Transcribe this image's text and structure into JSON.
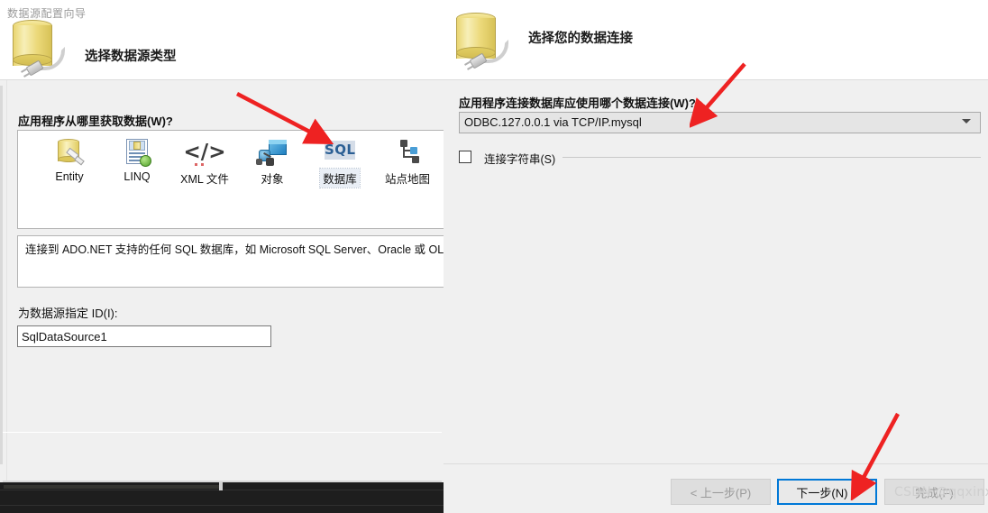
{
  "background": {
    "editor_color": "#1e1e1e"
  },
  "left_dialog": {
    "window_title": "数据源配置向导",
    "header_title": "选择数据源类型",
    "header_icon": "database-plug-icon",
    "question_label": "应用程序从哪里获取数据(W)?",
    "source_types": [
      {
        "label": "Entity",
        "icon": "entity-icon",
        "selected": false
      },
      {
        "label": "LINQ",
        "icon": "linq-icon",
        "selected": false
      },
      {
        "label": "XML 文件",
        "icon": "xml-file-icon",
        "selected": false
      },
      {
        "label": "对象",
        "icon": "object-icon",
        "selected": false
      },
      {
        "label": "数据库",
        "icon": "sql-database-icon",
        "selected": true
      },
      {
        "label": "站点地图",
        "icon": "site-map-icon",
        "selected": false
      }
    ],
    "description": "连接到 ADO.NET 支持的任何 SQL 数据库，如 Microsoft SQL Server、Oracle 或 OLE",
    "id_label": "为数据源指定 ID(I):",
    "id_value": "SqlDataSource1"
  },
  "right_dialog": {
    "header_title": "选择您的数据连接",
    "header_icon": "database-plug-icon",
    "question_label": "应用程序连接数据库应使用哪个数据连接(W)?",
    "connection_value": "ODBC.127.0.0.1 via TCP/IP.mysql",
    "connection_caret": "chevron-down-icon",
    "connection_string_checkbox": {
      "label": "连接字符串(S)",
      "checked": false
    },
    "buttons": [
      {
        "label": "< 上一步(P)",
        "state": "disabled"
      },
      {
        "label": "下一步(N) >",
        "state": "focused"
      },
      {
        "label": "完成(F)",
        "state": "disabled"
      }
    ]
  },
  "annotations": {
    "arrows": [
      {
        "name": "arrow-to-database-type",
        "color": "#ee2222"
      },
      {
        "name": "arrow-to-connection-combo",
        "color": "#ee2222"
      },
      {
        "name": "arrow-to-next-button",
        "color": "#ee2222"
      }
    ],
    "watermark": "CSDN @qqxinxi"
  }
}
